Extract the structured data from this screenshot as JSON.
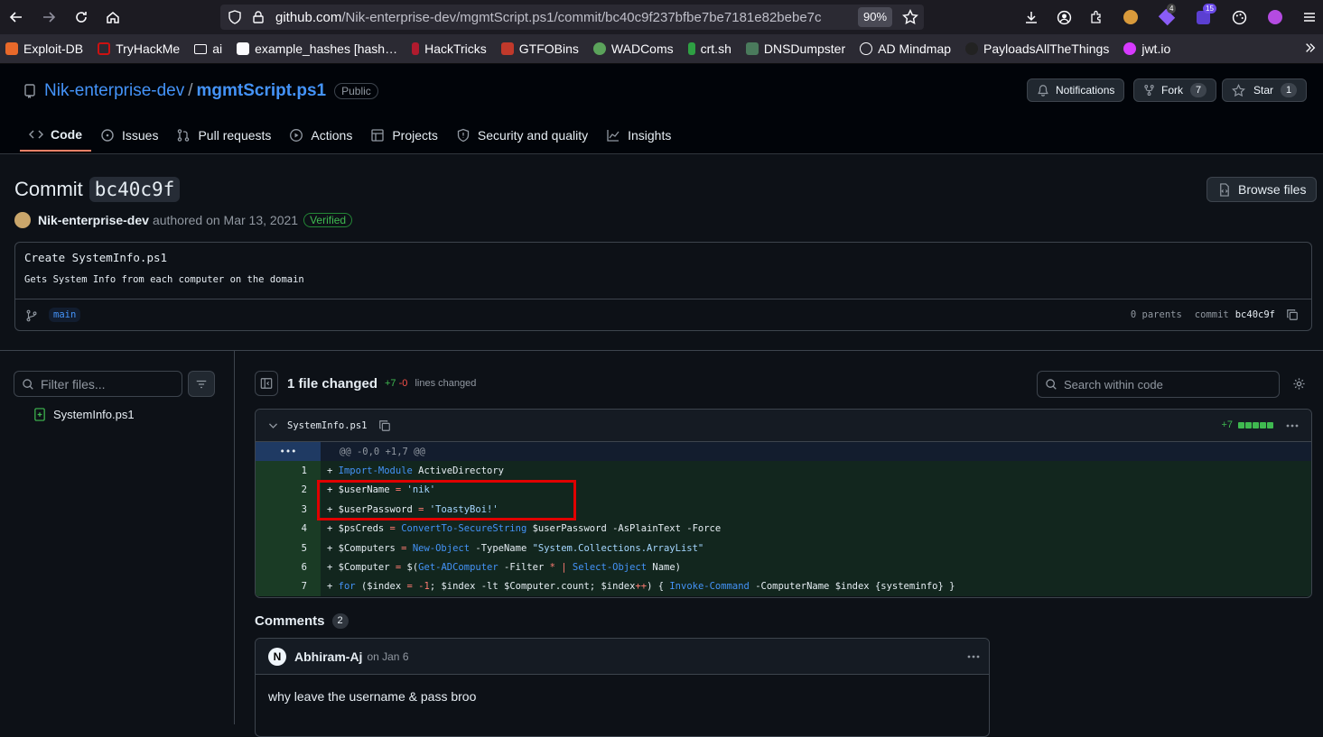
{
  "browser": {
    "url_domain": "github.com",
    "url_path": "/Nik-enterprise-dev/mgmtScript.ps1/commit/bc40c9f237bfbe7be7181e82bebe7c",
    "zoom": "90%",
    "ext_badge_1": "4",
    "ext_badge_2": "15"
  },
  "bookmarks": [
    "Exploit-DB",
    "TryHackMe",
    "ai",
    "example_hashes [hash…",
    "HackTricks",
    "GTFOBins",
    "WADComs",
    "crt.sh",
    "DNSDumpster",
    "AD Mindmap",
    "PayloadsAllTheThings",
    "jwt.io"
  ],
  "repo": {
    "owner": "Nik-enterprise-dev",
    "sep": "/",
    "name": "mgmtScript.ps1",
    "visibility": "Public",
    "notifications_label": "Notifications",
    "fork_label": "Fork",
    "fork_count": "7",
    "star_label": "Star",
    "star_count": "1"
  },
  "tabs": [
    "Code",
    "Issues",
    "Pull requests",
    "Actions",
    "Projects",
    "Security and quality",
    "Insights"
  ],
  "commit": {
    "title_prefix": "Commit",
    "short_hash": "bc40c9f",
    "browse_label": "Browse files",
    "author": "Nik-enterprise-dev",
    "authored_text": "authored on Mar 13, 2021",
    "verified": "Verified",
    "message": "Create SystemInfo.ps1",
    "description": "Gets System Info from each computer on the domain",
    "branch": "main",
    "parents": "0 parents",
    "commit_label": "commit",
    "commit_hash": "bc40c9f"
  },
  "files": {
    "filter_placeholder": "Filter files...",
    "items": [
      "SystemInfo.ps1"
    ]
  },
  "diff": {
    "summary": "1 file changed",
    "additions": "+7",
    "deletions": "-0",
    "lines_label": "lines changed",
    "search_placeholder": "Search within code",
    "file_name": "SystemInfo.ps1",
    "file_additions": "+7",
    "hunk": "@@ -0,0 +1,7 @@",
    "hunk_expand": "•••",
    "lines": [
      {
        "num": "1",
        "text": "+ Import-Module ActiveDirectory"
      },
      {
        "num": "2",
        "text": "+ $userName = 'nik'"
      },
      {
        "num": "3",
        "text": "+ $userPassword = 'ToastyBoi!'"
      },
      {
        "num": "4",
        "text": "+ $psCreds = ConvertTo-SecureString $userPassword -AsPlainText -Force"
      },
      {
        "num": "5",
        "text": "+ $Computers = New-Object -TypeName \"System.Collections.ArrayList\""
      },
      {
        "num": "6",
        "text": "+ $Computer = $(Get-ADComputer -Filter * | Select-Object Name)"
      },
      {
        "num": "7",
        "text": "+ for ($index = -1; $index -lt $Computer.count; $index++) { Invoke-Command -ComputerName $index {systeminfo} }"
      }
    ]
  },
  "comments": {
    "heading": "Comments",
    "count": "2",
    "items": [
      {
        "author": "Abhiram-Aj",
        "date": "on Jan 6",
        "body": "why leave the username & pass broo"
      }
    ]
  }
}
